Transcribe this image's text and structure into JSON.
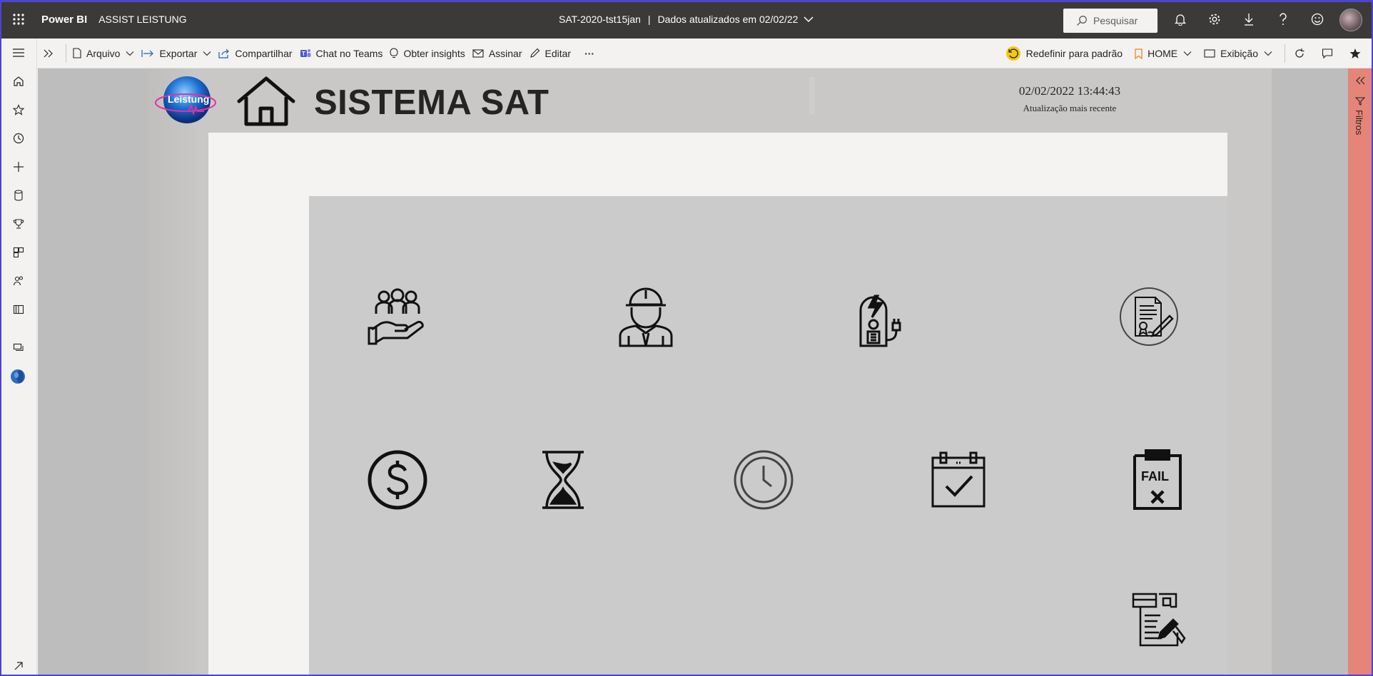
{
  "app": {
    "brand": "Power BI",
    "workspace": "ASSIST LEISTUNG",
    "report_name": "SAT-2020-tst15jan",
    "separator": "|",
    "refresh_text": "Dados atualizados em 02/02/22"
  },
  "search": {
    "placeholder": "Pesquisar"
  },
  "toolbar": {
    "file": "Arquivo",
    "export": "Exportar",
    "share": "Compartilhar",
    "teams": "Chat no Teams",
    "insights": "Obter insights",
    "subscribe": "Assinar",
    "edit": "Editar",
    "more": "···",
    "reset": "Redefinir para padrão",
    "bookmark": "HOME",
    "view": "Exibição"
  },
  "report": {
    "logo_text": "Leistung",
    "title": "SISTEMA SAT",
    "datetime": "02/02/2022 13:44:43",
    "datetime_label": "Atualização mais recente"
  },
  "filters": {
    "label": "Filtros"
  },
  "tiles": [
    "customers-icon",
    "technician-icon",
    "equipment-icon",
    "contract-icon",
    "money-icon",
    "hourglass-icon",
    "clock-icon",
    "calendar-check-icon",
    "fail-icon",
    "report-edit-icon"
  ],
  "colors": {
    "topbar": "#3b3a39",
    "filters_pane": "#e5857a",
    "canvas": "#c9c8c6"
  }
}
